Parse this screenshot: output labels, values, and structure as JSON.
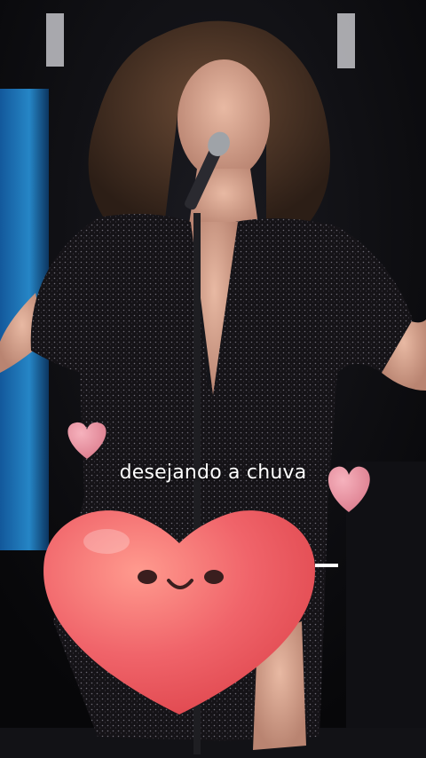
{
  "caption": {
    "text": "desejando a chuva"
  },
  "stickers": {
    "big_heart": {
      "icon": "smiling-heart-icon"
    },
    "small_hearts": [
      "heart-icon",
      "heart-icon"
    ]
  },
  "colors": {
    "heart_main": "#f0646a",
    "heart_small": "#e98a9a",
    "stage_blue": "#1e88d8",
    "dress": "#141216"
  }
}
